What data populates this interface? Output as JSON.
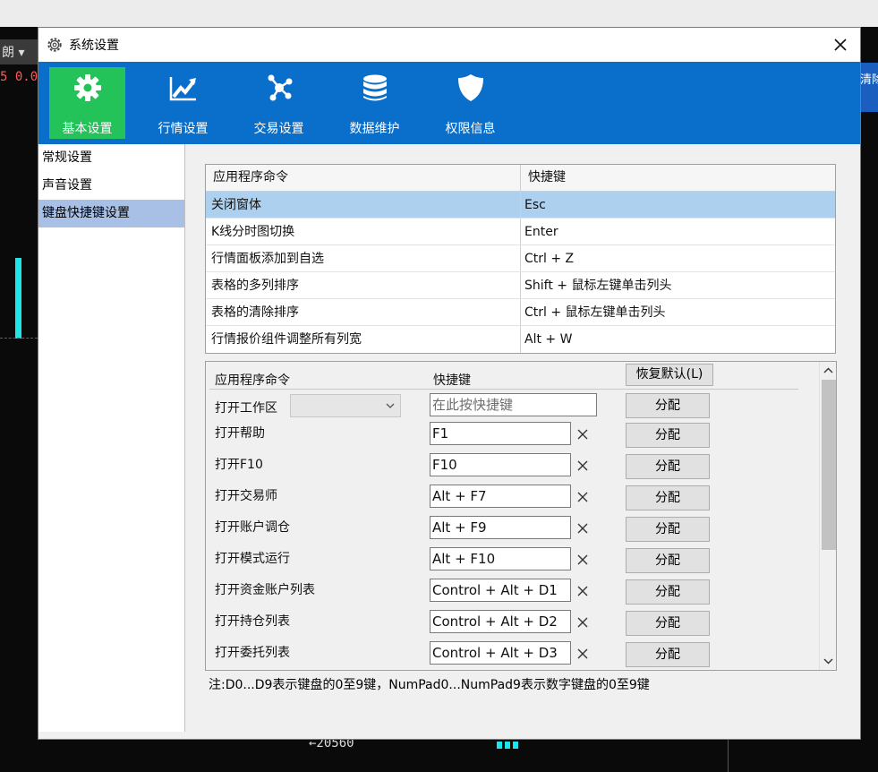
{
  "background": {
    "left_toolbar_text": "朗 ▾",
    "left_value": "5 0.0",
    "right_strip_text": "清除",
    "bottom_label": "←20560"
  },
  "dialog": {
    "title": "系统设置",
    "title_icon": "gear-icon",
    "close_icon": "close-icon"
  },
  "toolbar": {
    "items": [
      {
        "label": "基本设置",
        "icon": "gear-icon",
        "active": true
      },
      {
        "label": "行情设置",
        "icon": "chart-trend-icon",
        "active": false
      },
      {
        "label": "交易设置",
        "icon": "trade-network-icon",
        "active": false
      },
      {
        "label": "数据维护",
        "icon": "database-icon",
        "active": false
      },
      {
        "label": "权限信息",
        "icon": "shield-icon",
        "active": false
      }
    ]
  },
  "sidebar": {
    "items": [
      {
        "label": "常规设置",
        "active": false
      },
      {
        "label": "声音设置",
        "active": false
      },
      {
        "label": "键盘快捷键设置",
        "active": true
      }
    ]
  },
  "shortcut_table": {
    "headers": [
      "应用程序命令",
      "快捷键"
    ],
    "rows": [
      {
        "command": "关闭窗体",
        "key": "Esc",
        "selected": true
      },
      {
        "command": "K线分时图切换",
        "key": "Enter",
        "selected": false
      },
      {
        "command": "行情面板添加到自选",
        "key": "Ctrl + Z",
        "selected": false
      },
      {
        "command": "表格的多列排序",
        "key": "Shift + 鼠标左键单击列头",
        "selected": false
      },
      {
        "command": "表格的清除排序",
        "key": "Ctrl + 鼠标左键单击列头",
        "selected": false
      },
      {
        "command": "行情报价组件调整所有列宽",
        "key": "Alt + W",
        "selected": false
      }
    ]
  },
  "assign_panel": {
    "header_command": "应用程序命令",
    "header_key": "快捷键",
    "restore_label": "恢复默认(L)",
    "workspace_label": "打开工作区",
    "workspace_placeholder": "在此按快捷键",
    "assign_label": "分配",
    "rows": [
      {
        "command": "打开帮助",
        "key": "F1"
      },
      {
        "command": "打开F10",
        "key": "F10"
      },
      {
        "command": "打开交易师",
        "key": "Alt + F7"
      },
      {
        "command": "打开账户调仓",
        "key": "Alt + F9"
      },
      {
        "command": "打开模式运行",
        "key": "Alt + F10"
      },
      {
        "command": "打开资金账户列表",
        "key": "Control + Alt + D1"
      },
      {
        "command": "打开持仓列表",
        "key": "Control + Alt + D2"
      },
      {
        "command": "打开委托列表",
        "key": "Control + Alt + D3"
      }
    ]
  },
  "note": "注:D0...D9表示键盘的0至9键，NumPad0...NumPad9表示数字键盘的0至9键",
  "colors": {
    "toolbar_bg": "#0a6fcb",
    "active_tool": "#23c35a",
    "selected_row": "#acd0ee",
    "active_sidebar": "#a9c0e6"
  }
}
